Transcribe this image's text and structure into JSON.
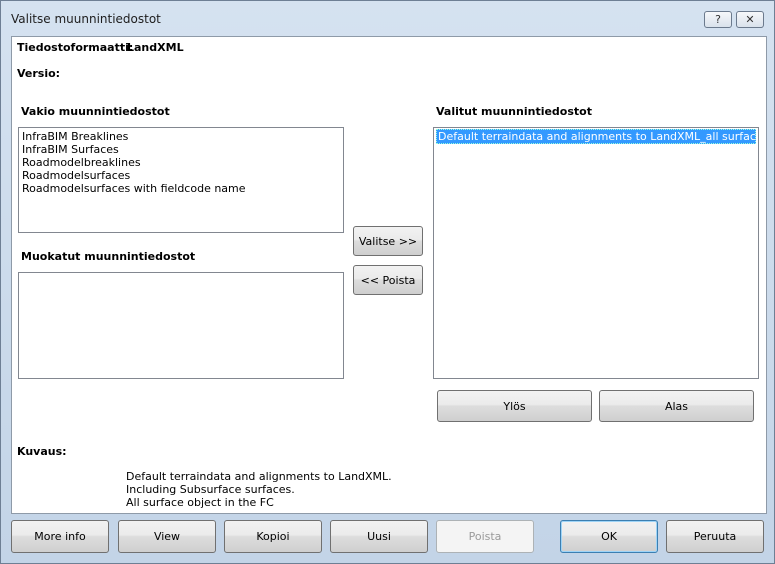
{
  "window": {
    "title": "Valitse muunnintiedostot",
    "help_label": "?",
    "close_label": "✕"
  },
  "format": {
    "label": "Tiedostoformaatti:",
    "value": "LandXML"
  },
  "version": {
    "label": "Versio:"
  },
  "standard": {
    "label": "Vakio muunnintiedostot",
    "items": [
      "InfraBIM Breaklines",
      "InfraBIM Surfaces",
      "Roadmodelbreaklines",
      "Roadmodelsurfaces",
      "Roadmodelsurfaces with fieldcode name"
    ]
  },
  "custom": {
    "label": "Muokatut muunnintiedostot"
  },
  "selected": {
    "label": "Valitut muunnintiedostot",
    "items": [
      "Default terraindata and alignments to LandXML_all surfaces"
    ]
  },
  "buttons": {
    "select": "Valitse >>",
    "remove": "<< Poista",
    "up": "Ylös",
    "down": "Alas"
  },
  "description": {
    "label": "Kuvaus:",
    "lines": [
      "Default terraindata and alignments to LandXML.",
      "Including Subsurface surfaces.",
      "All surface object in the FC"
    ]
  },
  "footer": {
    "more_info": "More info",
    "view": "View",
    "copy": "Kopioi",
    "new": "Uusi",
    "delete": "Poista",
    "ok": "OK",
    "cancel": "Peruuta"
  }
}
